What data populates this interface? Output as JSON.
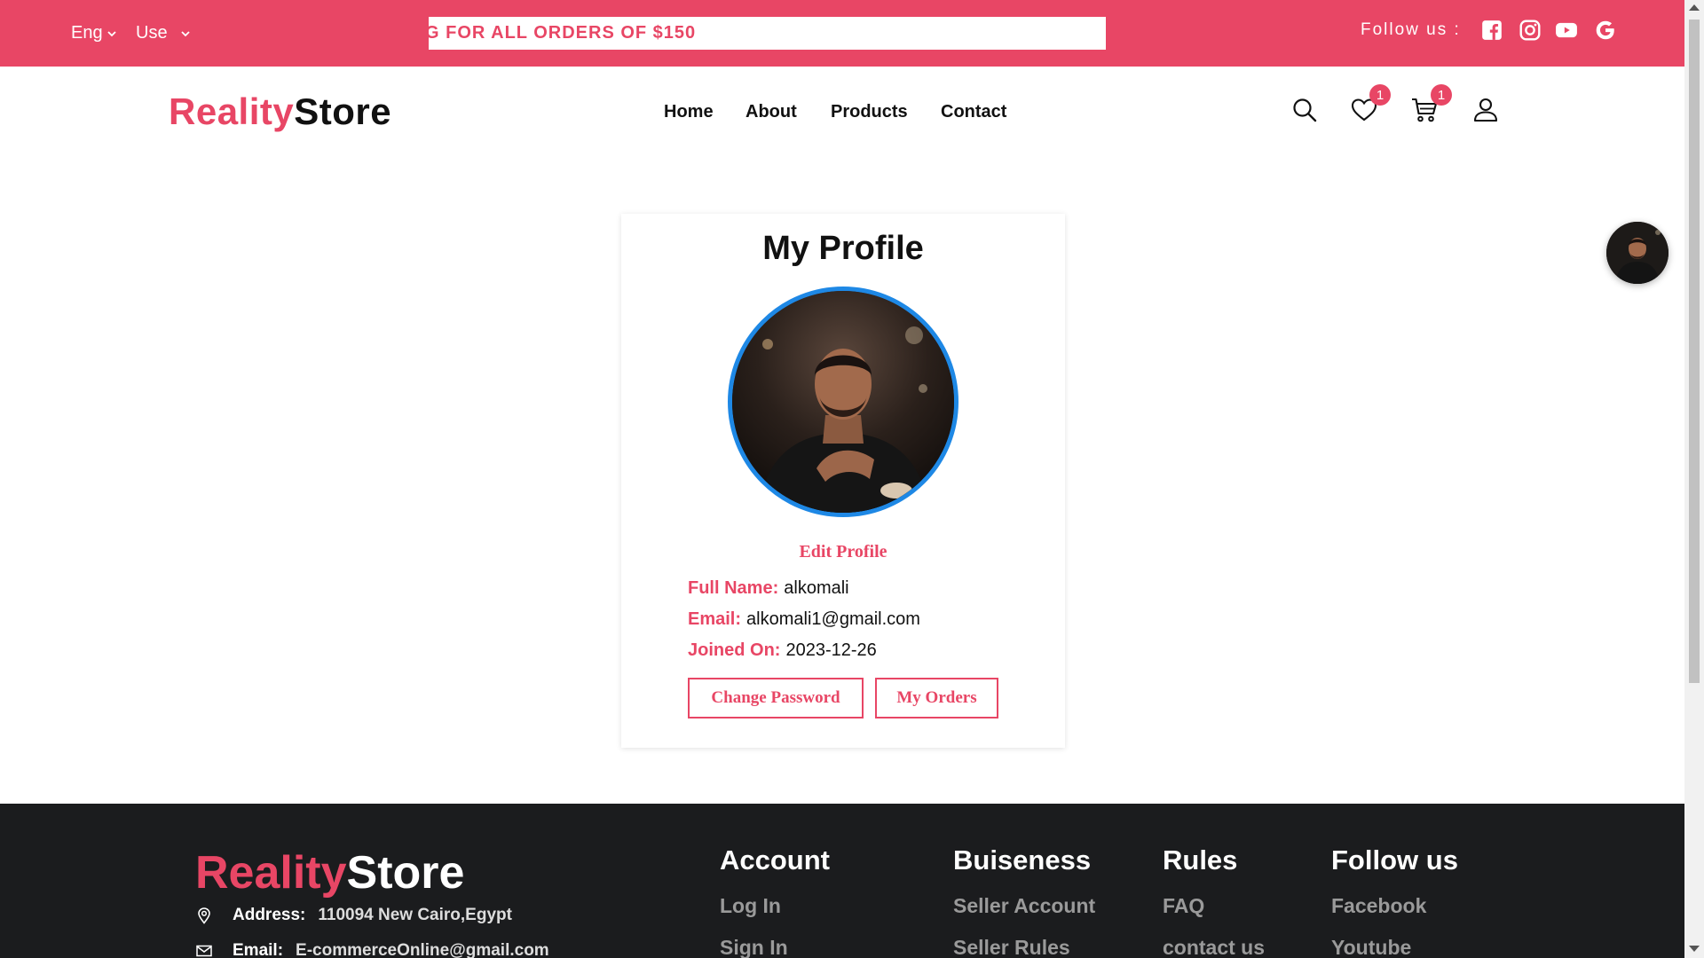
{
  "topbar": {
    "lang_label": "Eng",
    "currency_label": "Use",
    "ticker_text": "G FOR ALL ORDERS OF $150",
    "follow_label": "Follow us :",
    "social_icons": [
      "facebook-icon",
      "instagram-icon",
      "youtube-icon",
      "google-icon"
    ]
  },
  "header": {
    "logo_part1": "Reality",
    "logo_part2": "Store",
    "nav": [
      "Home",
      "About",
      "Products",
      "Contact"
    ],
    "wishlist_count": "1",
    "cart_count": "1"
  },
  "profile": {
    "title": "My Profile",
    "edit_label": "Edit Profile",
    "full_name_label": "Full Name:",
    "full_name": "alkomali",
    "email_label": "Email:",
    "email": "alkomali1@gmail.com",
    "joined_label": "Joined On:",
    "joined": "2023-12-26",
    "change_password_label": "Change Password",
    "my_orders_label": "My Orders"
  },
  "footer": {
    "logo_part1": "Reality",
    "logo_part2": "Store",
    "address_label": "Address:",
    "address": "110094 New Cairo,Egypt",
    "email_label": "Email:",
    "email": "E-commerceOnline@gmail.com",
    "columns": [
      {
        "title": "Account",
        "links": [
          "Log In",
          "Sign In"
        ]
      },
      {
        "title": "Buiseness",
        "links": [
          "Seller Account",
          "Seller Rules"
        ]
      },
      {
        "title": "Rules",
        "links": [
          "FAQ",
          "contact us"
        ]
      },
      {
        "title": "Follow us",
        "links": [
          "Facebook",
          "Youtube"
        ]
      }
    ]
  },
  "colors": {
    "accent": "#e84665",
    "footer_bg": "#1b1c1e",
    "avatar_ring": "#1e88e5"
  }
}
